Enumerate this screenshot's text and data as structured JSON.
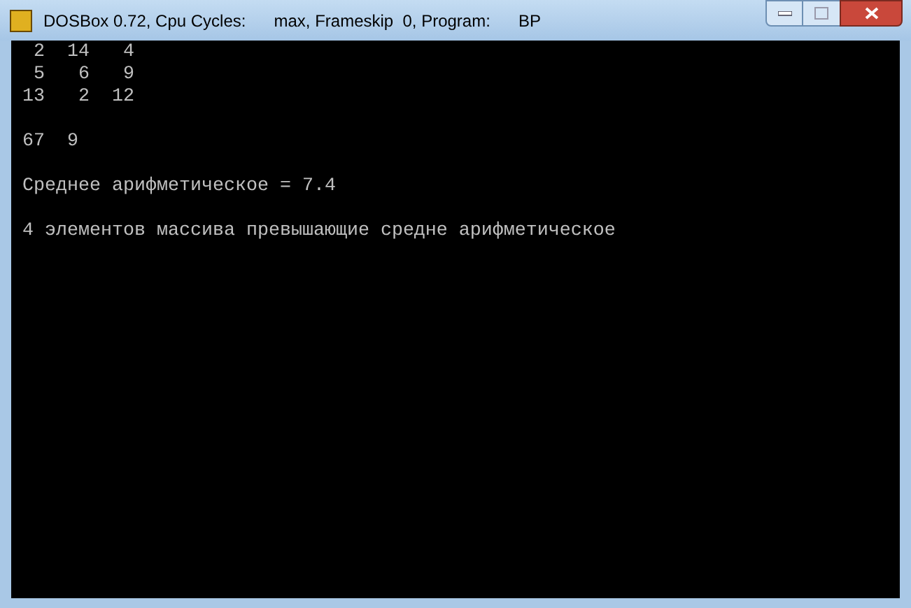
{
  "window": {
    "title": "DOSBox 0.72, Cpu Cycles:      max, Frameskip  0, Program:      BP"
  },
  "console": {
    "blocks": [
      [
        " 2  14   4",
        " 5   6   9",
        "13   2  12"
      ],
      [
        "67  9"
      ],
      [
        "Среднее арифметическое = 7.4"
      ],
      [
        "4 элементов массива превышающие средне арифметическое"
      ]
    ]
  }
}
